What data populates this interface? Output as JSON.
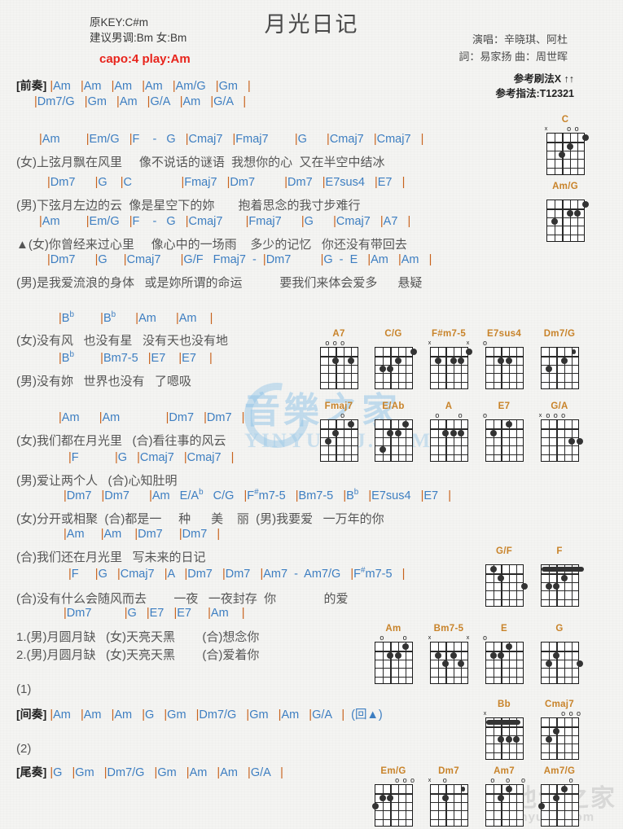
{
  "header": {
    "title": "月光日记",
    "orig_key": "原KEY:C#m",
    "suggest_key": "建议男调:Bm 女:Bm",
    "capo": "capo:4 play:Am",
    "singer": "演唱：辛晓琪、阿杜",
    "writers": "詞：易家扬  曲：周世晖",
    "strum": "参考刷法X ↑↑",
    "fingering": "参考指法:T12321",
    "accent_chord": "#3d7ec1",
    "accent_bar": "#c8621c",
    "accent_capo": "#e8241c",
    "accent_chordname": "#c8832a"
  },
  "sections": {
    "intro_label": "[前奏]",
    "interlude_label": "[间奏]",
    "outro_label": "[尾奏]",
    "repeat_1": "(1)",
    "repeat_2": "(2)",
    "back_to_triangle": "(回▲)"
  },
  "lines": [
    {
      "id": "intro1",
      "type": "chord",
      "text": "[前奏] |Am   |Am   |Am   |Am   |Am/G   |Gm   |"
    },
    {
      "id": "intro2",
      "type": "chord",
      "text": "|Dm7/G   |Gm   |Am   |G/A   |Am   |G/A   |"
    },
    {
      "id": "v1c1",
      "type": "chord",
      "text": "|Am        |Em/G   |F    -   G   |Cmaj7   |Fmaj7        |G      |Cmaj7   |Cmaj7   |"
    },
    {
      "id": "v1l1",
      "type": "lyric",
      "text": "(女)上弦月飘在风里     像不说话的谜语  我想你的心  又在半空中结冰"
    },
    {
      "id": "v1c2",
      "type": "chord",
      "text": "|Dm7      |G    |C               |Fmaj7   |Dm7         |Dm7   |E7sus4   |E7   |"
    },
    {
      "id": "v1l2",
      "type": "lyric",
      "text": "(男)下弦月左边的云  像是星空下的妳       抱着思念的我寸步难行"
    },
    {
      "id": "v1c3",
      "type": "chord",
      "text": "|Am        |Em/G   |F    -   G   |Cmaj7       |Fmaj7      |G      |Cmaj7   |A7   |"
    },
    {
      "id": "v1l3",
      "type": "lyric",
      "text": "▲(女)你曾经来过心里     像心中的一场雨    多少的记忆   你还没有带回去"
    },
    {
      "id": "v1c4",
      "type": "chord",
      "text": "|Dm7      |G     |Cmaj7      |G/F   Fmaj7  -  |Dm7         |G  -  E   |Am   |Am   |"
    },
    {
      "id": "v1l4",
      "type": "lyric",
      "text": "(男)是我爱流浪的身体   或是妳所谓的命运           要我们来体会爱多      悬疑"
    },
    {
      "id": "v2c1",
      "type": "chord",
      "text": "|B♭        |B♭      |Am      |Am    |"
    },
    {
      "id": "v2l1",
      "type": "lyric",
      "text": "(女)没有风   也没有星   没有天也没有地"
    },
    {
      "id": "v2c2",
      "type": "chord",
      "text": "|B♭        |Bm7-5   |E7    |E7    |"
    },
    {
      "id": "v2l2",
      "type": "lyric",
      "text": "(男)没有妳   世界也没有   了嗯吸"
    },
    {
      "id": "v3c1",
      "type": "chord",
      "text": "|Am      |Am              |Dm7   |Dm7   |"
    },
    {
      "id": "v3l1",
      "type": "lyric",
      "text": "(女)我们都在月光里   (合)看往事的风云"
    },
    {
      "id": "v3c2",
      "type": "chord",
      "text": "|F           |G   |Cmaj7   |Cmaj7   |"
    },
    {
      "id": "v3l2",
      "type": "lyric",
      "text": "(男)爱让两个人   (合)心知肚明"
    },
    {
      "id": "v4c1",
      "type": "chord",
      "text": "|Dm7   |Dm7      |Am   E/A♭   C/G   |F♯m7-5   |Bm7-5   |B♭   |E7sus4   |E7   |"
    },
    {
      "id": "v4l1",
      "type": "lyric",
      "text": "(女)分开或相聚  (合)都是一     种      美    丽  (男)我要爱   一万年的你"
    },
    {
      "id": "v4c2",
      "type": "chord",
      "text": "|Am     |Am    |Dm7     |Dm7   |"
    },
    {
      "id": "v4l2",
      "type": "lyric",
      "text": "(合)我们还在月光里   写未来的日记"
    },
    {
      "id": "v4c3",
      "type": "chord",
      "text": "|F     |G   |Cmaj7   |A   |Dm7   |Dm7   |Am7  -  Am7/G   |F♯m7-5   |"
    },
    {
      "id": "v4l3",
      "type": "lyric",
      "text": "(合)没有什么会随风而去        一夜   一夜封存  你              的爱"
    },
    {
      "id": "v4c4",
      "type": "chord",
      "text": "|Dm7          |G   |E7   |E7     |Am    |"
    },
    {
      "id": "end1",
      "type": "lyric",
      "text": "1.(男)月圆月缺   (女)天亮天黑        (合)想念你"
    },
    {
      "id": "end2",
      "type": "lyric",
      "text": "2.(男)月圆月缺   (女)天亮天黑        (合)爱着你"
    },
    {
      "id": "r1",
      "type": "lyric",
      "text": "(1)"
    },
    {
      "id": "interlude",
      "type": "chord",
      "text": "[间奏] |Am   |Am   |Am   |G   |Gm   |Dm7/G   |Gm   |Am   |G/A   |  (回▲)"
    },
    {
      "id": "r2",
      "type": "lyric",
      "text": "(2)"
    },
    {
      "id": "outro",
      "type": "chord",
      "text": "[尾奏] |G   |Gm   |Dm7/G   |Gm   |Am   |Am   |G/A   |"
    }
  ],
  "chord_diagrams": [
    {
      "name": "C",
      "markers": "x..oo.",
      "dots": [
        [
          2,
          3
        ],
        [
          3,
          2
        ],
        [
          1,
          5
        ]
      ],
      "barre": null
    },
    {
      "name": "Am/G",
      "markers": "......",
      "dots": [
        [
          2,
          4
        ],
        [
          2,
          3
        ],
        [
          1,
          5
        ],
        [
          3,
          1
        ]
      ],
      "barre": null
    },
    {
      "name": "A7",
      "markers": ".ooo..",
      "dots": [
        [
          2,
          2
        ],
        [
          2,
          4
        ]
      ],
      "barre": null
    },
    {
      "name": "C/G",
      "markers": "......",
      "dots": [
        [
          3,
          1
        ],
        [
          3,
          2
        ],
        [
          2,
          3
        ],
        [
          1,
          5
        ]
      ],
      "barre": null
    },
    {
      "name": "F#m7-5",
      "markers": "x....x",
      "dots": [
        [
          2,
          1
        ],
        [
          2,
          3
        ],
        [
          2,
          4
        ],
        [
          1,
          5
        ]
      ],
      "barre": null
    },
    {
      "name": "E7sus4",
      "markers": "o.....",
      "dots": [
        [
          2,
          2
        ],
        [
          2,
          3
        ]
      ],
      "barre": null
    },
    {
      "name": "Dm7/G",
      "markers": "......",
      "dots": [
        [
          3,
          1
        ],
        [
          2,
          3
        ]
      ],
      "barre": [
        5,
        5,
        1
      ]
    },
    {
      "name": "Fmaj7",
      "markers": "...o..",
      "dots": [
        [
          3,
          1
        ],
        [
          2,
          2
        ],
        [
          1,
          4
        ]
      ],
      "barre": null
    },
    {
      "name": "E/Ab",
      "markers": "......",
      "dots": [
        [
          4,
          1
        ],
        [
          2,
          2
        ],
        [
          2,
          3
        ],
        [
          1,
          4
        ]
      ],
      "barre": null
    },
    {
      "name": "A",
      "markers": ".o..o.",
      "dots": [
        [
          2,
          2
        ],
        [
          2,
          3
        ],
        [
          2,
          4
        ]
      ],
      "barre": null
    },
    {
      "name": "E7",
      "markers": "o.....",
      "dots": [
        [
          2,
          1
        ],
        [
          1,
          3
        ]
      ],
      "barre": null
    },
    {
      "name": "G/A",
      "markers": "xooo..",
      "dots": [
        [
          3,
          4
        ],
        [
          3,
          5
        ]
      ],
      "barre": null
    },
    {
      "name": "G/F",
      "markers": "......",
      "dots": [
        [
          1,
          1
        ],
        [
          2,
          2
        ],
        [
          3,
          5
        ]
      ],
      "barre": null
    },
    {
      "name": "F",
      "markers": "......",
      "dots": [
        [
          2,
          3
        ],
        [
          3,
          2
        ],
        [
          3,
          1
        ]
      ],
      "barre": [
        1,
        6,
        1
      ]
    },
    {
      "name": "Am",
      "markers": ".o..o.",
      "dots": [
        [
          2,
          2
        ],
        [
          2,
          3
        ],
        [
          1,
          4
        ]
      ],
      "barre": null
    },
    {
      "name": "Bm7-5",
      "markers": "x....x",
      "dots": [
        [
          2,
          1
        ],
        [
          3,
          2
        ],
        [
          2,
          3
        ],
        [
          3,
          4
        ]
      ],
      "barre": null
    },
    {
      "name": "E",
      "markers": "o.....",
      "dots": [
        [
          2,
          1
        ],
        [
          2,
          2
        ],
        [
          1,
          3
        ]
      ],
      "barre": null
    },
    {
      "name": "G",
      "markers": "......",
      "dots": [
        [
          3,
          1
        ],
        [
          2,
          2
        ],
        [
          3,
          5
        ]
      ],
      "barre": null
    },
    {
      "name": "Bb",
      "markers": "x.....",
      "dots": [
        [
          3,
          2
        ],
        [
          3,
          3
        ],
        [
          3,
          4
        ]
      ],
      "barre": [
        1,
        5,
        1
      ]
    },
    {
      "name": "Cmaj7",
      "markers": "...ooo",
      "dots": [
        [
          3,
          1
        ],
        [
          2,
          2
        ]
      ],
      "barre": null
    },
    {
      "name": "Em/G",
      "markers": "...ooo",
      "dots": [
        [
          3,
          0
        ],
        [
          2,
          1
        ],
        [
          2,
          2
        ]
      ],
      "barre": null
    },
    {
      "name": "Dm7",
      "markers": "x.o...",
      "dots": [
        [
          2,
          2
        ]
      ],
      "barre": [
        5,
        5,
        1
      ]
    },
    {
      "name": "Am7",
      "markers": ".o.o.o",
      "dots": [
        [
          2,
          2
        ],
        [
          1,
          3
        ]
      ],
      "barre": null
    },
    {
      "name": "Am7/G",
      "markers": "....o.",
      "dots": [
        [
          3,
          0
        ],
        [
          2,
          2
        ],
        [
          1,
          3
        ]
      ],
      "barre": null
    }
  ],
  "watermarks": {
    "brand_cn": "音樂之家",
    "brand_en": "YINYUEZJ.COM",
    "footer_cn": "吉他谱之家",
    "footer_en": "yinyuezj.com"
  }
}
